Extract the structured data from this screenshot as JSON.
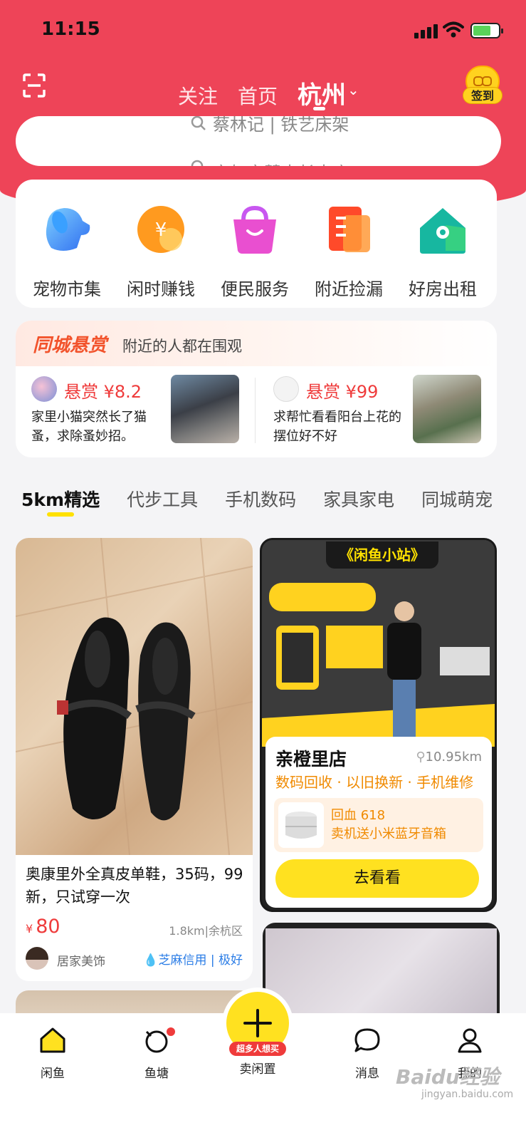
{
  "status_bar": {
    "time": "11:15"
  },
  "header": {
    "tabs": [
      "关注",
      "首页"
    ],
    "city": "杭州",
    "signin_label": "签到",
    "search_hint": "蔡林记 | 铁艺床架",
    "search_hint_next": "家如家慧水长大店"
  },
  "categories": [
    {
      "label": "宠物市集",
      "icon": "dog-icon"
    },
    {
      "label": "闲时赚钱",
      "icon": "coin-icon"
    },
    {
      "label": "便民服务",
      "icon": "bag-icon"
    },
    {
      "label": "附近捡漏",
      "icon": "document-icon"
    },
    {
      "label": "好房出租",
      "icon": "house-icon"
    }
  ],
  "bounty": {
    "title": "同城悬赏",
    "subtitle": "附近的人都在围观",
    "items": [
      {
        "amount": "悬赏 ¥8.2",
        "desc": "家里小猫突然长了猫蚤，求除蚤妙招。"
      },
      {
        "amount": "悬赏 ¥99",
        "desc": "求帮忙看看阳台上花的摆位好不好"
      }
    ]
  },
  "feed_tabs": [
    "5km精选",
    "代步工具",
    "手机数码",
    "家具家电",
    "同城萌宠"
  ],
  "product": {
    "title": "奥康里外全真皮单鞋，35码，99新，只试穿一次",
    "currency": "¥",
    "price": "80",
    "location": "1.8km|余杭区",
    "seller": "居家美饰",
    "credit": "芝麻信用 | 极好"
  },
  "store": {
    "banner": "《闲鱼小站》",
    "name": "亲橙里店",
    "distance": "10.95km",
    "services": "数码回收 · 以旧换新 · 手机维修",
    "promo_line1": "回血 618",
    "promo_line2": "卖机送小米蓝牙音箱",
    "button": "去看看"
  },
  "bottom_nav": {
    "items": [
      "闲鱼",
      "鱼塘",
      "消息",
      "我的"
    ],
    "sell_tag": "超多人想买",
    "sell_label": "卖闲置"
  },
  "watermark": {
    "brand": "Baidu经验",
    "url": "jingyan.baidu.com"
  },
  "colors": {
    "header_red": "#ee4458",
    "accent_yellow": "#ffe120",
    "price_red": "#ef3b3b",
    "orange": "#f08a00"
  }
}
